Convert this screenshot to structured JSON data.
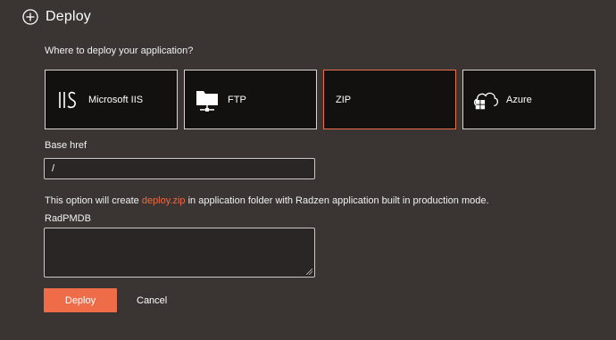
{
  "dialog": {
    "title": "Deploy"
  },
  "question": "Where to deploy your application?",
  "targets": [
    {
      "label": "Microsoft IIS",
      "icon": "iis-icon",
      "selected": false
    },
    {
      "label": "FTP",
      "icon": "ftp-folder-icon",
      "selected": false
    },
    {
      "label": "ZIP",
      "icon": "",
      "selected": true
    },
    {
      "label": "Azure",
      "icon": "azure-cloud-icon",
      "selected": false
    }
  ],
  "base_href": {
    "label": "Base href",
    "value": "/"
  },
  "info": {
    "prefix": "This option will create ",
    "highlight": "deploy.zip",
    "suffix": " in application folder with Radzen application built in production mode."
  },
  "radpmdb": {
    "label": "RadPMDB",
    "value": ""
  },
  "buttons": {
    "deploy": "Deploy",
    "cancel": "Cancel"
  },
  "colors": {
    "accent": "#ee6c47",
    "background": "#3a3533",
    "card": "#121110"
  }
}
